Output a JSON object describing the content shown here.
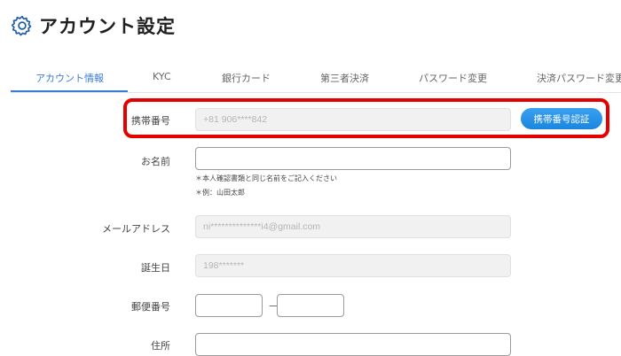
{
  "header": {
    "title": "アカウント設定",
    "icon": "gear-icon"
  },
  "tabs": [
    {
      "label": "アカウント情報",
      "active": true
    },
    {
      "label": "KYC",
      "active": false
    },
    {
      "label": "銀行カード",
      "active": false
    },
    {
      "label": "第三者決済",
      "active": false
    },
    {
      "label": "パスワード変更",
      "active": false
    },
    {
      "label": "決済パスワード変更",
      "active": false
    }
  ],
  "form": {
    "phone": {
      "label": "携帯番号",
      "value": "+81 906****842",
      "verify_button": "携帯番号認証"
    },
    "name": {
      "label": "お名前",
      "value": "",
      "notes": [
        "＊本人確認書類と同じ名前をご記入ください",
        "＊例：山田太郎"
      ]
    },
    "email": {
      "label": "メールアドレス",
      "value": "ni**************i4@gmail.com"
    },
    "birthday": {
      "label": "誕生日",
      "value": "198*******"
    },
    "postal": {
      "label": "郵便番号",
      "part1": "",
      "separator": "－",
      "part2": ""
    },
    "address": {
      "label": "住所",
      "value": ""
    }
  },
  "colors": {
    "accent": "#3a7bd5",
    "button": "#1a86e0",
    "highlight": "#e50000"
  }
}
